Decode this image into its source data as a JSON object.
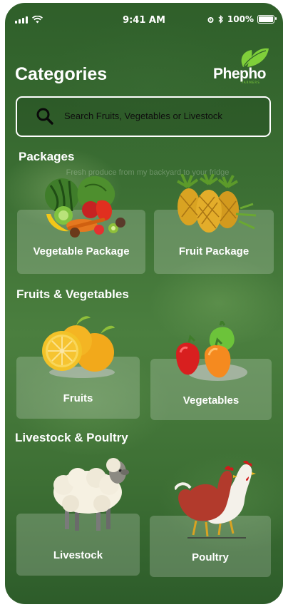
{
  "status_bar": {
    "time": "9:41 AM",
    "battery": "100%"
  },
  "header": {
    "title": "Categories",
    "logo_text": "Phepho",
    "logo_sub": "FARMERS"
  },
  "search": {
    "placeholder": "Search Fruits, Vegetables or Livestock"
  },
  "sections": {
    "packages": {
      "title": "Packages",
      "tagline": "Fresh produce from my backyard to your fridge",
      "items": [
        {
          "label": "Vegetable Package"
        },
        {
          "label": "Fruit Package"
        }
      ]
    },
    "fruits_vegetables": {
      "title": "Fruits & Vegetables",
      "items": [
        {
          "label": "Fruits"
        },
        {
          "label": "Vegetables"
        }
      ]
    },
    "livestock_poultry": {
      "title": "Livestock & Poultry",
      "items": [
        {
          "label": "Livestock"
        },
        {
          "label": "Poultry"
        }
      ]
    }
  },
  "icons": {
    "search": "search-icon",
    "signal": "signal-icon",
    "wifi": "wifi-icon",
    "alarm": "alarm-icon",
    "bluetooth": "bluetooth-icon",
    "battery": "battery-icon"
  },
  "colors": {
    "background": "#3b6e33",
    "logo_green": "#7fcf3a",
    "card": "rgba(255,255,255,0.20)"
  }
}
